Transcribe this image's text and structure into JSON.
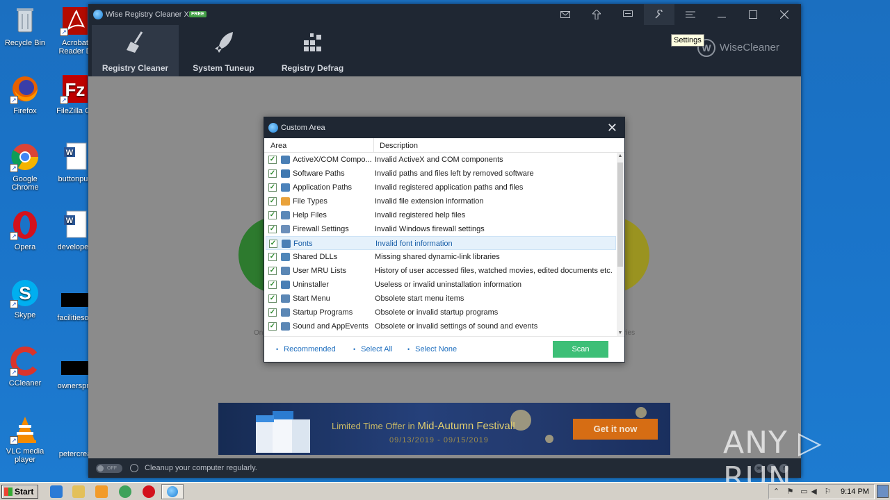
{
  "desktop": {
    "icons": [
      {
        "label": "Recycle Bin",
        "icon": "recycle-bin-icon"
      },
      {
        "label": "Acrobat Reader D",
        "icon": "acrobat-icon"
      },
      {
        "label": "Firefox",
        "icon": "firefox-icon"
      },
      {
        "label": "FileZilla Cli",
        "icon": "filezilla-icon"
      },
      {
        "label": "Google Chrome",
        "icon": "chrome-icon"
      },
      {
        "label": "buttonpub",
        "icon": "word-doc-icon"
      },
      {
        "label": "Opera",
        "icon": "opera-icon"
      },
      {
        "label": "developed",
        "icon": "word-doc-icon"
      },
      {
        "label": "Skype",
        "icon": "skype-icon"
      },
      {
        "label": "facilitiesop",
        "icon": "blank-file-icon"
      },
      {
        "label": "CCleaner",
        "icon": "ccleaner-icon"
      },
      {
        "label": "ownerspm",
        "icon": "blank-file-icon"
      },
      {
        "label": "VLC media player",
        "icon": "vlc-icon"
      },
      {
        "label": "petercrea",
        "icon": "blank-file-icon"
      }
    ]
  },
  "app": {
    "title": "Wise Registry Cleaner X",
    "badge": "FREE",
    "tabs": [
      {
        "label": "Registry Cleaner",
        "icon": "broom-icon"
      },
      {
        "label": "System Tuneup",
        "icon": "rocket-icon"
      },
      {
        "label": "Registry Defrag",
        "icon": "blocks-icon"
      }
    ],
    "brand": "WiseCleaner",
    "brand_letter": "W",
    "tooltip": "Settings",
    "status_toggle": "OFF",
    "status_text": "Cleanup your computer regularly.",
    "bg_left_text": "On",
    "bg_right_text": "ries",
    "banner": {
      "offer_prefix": "Limited Time Offer in",
      "offer_event": "Mid-Autumn Festival!",
      "dates": "09/13/2019 - 09/15/2019",
      "button": "Get it now"
    }
  },
  "dialog": {
    "title": "Custom Area",
    "col_area": "Area",
    "col_desc": "Description",
    "rows": [
      {
        "name": "ActiveX/COM Compo...",
        "desc": "Invalid ActiveX and COM components",
        "checked": true
      },
      {
        "name": "Software Paths",
        "desc": "Invalid paths and files left by removed software",
        "checked": true
      },
      {
        "name": "Application Paths",
        "desc": "Invalid registered application paths and files",
        "checked": true
      },
      {
        "name": "File Types",
        "desc": "Invalid file extension information",
        "checked": true
      },
      {
        "name": "Help Files",
        "desc": "Invalid registered help files",
        "checked": true
      },
      {
        "name": "Firewall Settings",
        "desc": "Invalid Windows firewall settings",
        "checked": true
      },
      {
        "name": "Fonts",
        "desc": "Invalid font information",
        "checked": true
      },
      {
        "name": "Shared DLLs",
        "desc": "Missing shared dynamic-link libraries",
        "checked": true
      },
      {
        "name": "User MRU Lists",
        "desc": "History of user accessed files, watched movies, edited documents etc.",
        "checked": true
      },
      {
        "name": "Uninstaller",
        "desc": "Useless or invalid uninstallation information",
        "checked": true
      },
      {
        "name": "Start Menu",
        "desc": "Obsolete start menu items",
        "checked": true
      },
      {
        "name": "Startup Programs",
        "desc": "Obsolete or invalid startup programs",
        "checked": true
      },
      {
        "name": "Sound and AppEvents",
        "desc": "Obsolete or invalid settings of sound and events",
        "checked": true
      }
    ],
    "selected_index": 6,
    "links": {
      "recommended": "Recommended",
      "select_all": "Select All",
      "select_none": "Select None"
    },
    "scan": "Scan"
  },
  "taskbar": {
    "start": "Start",
    "time": "9:14 PM"
  },
  "watermark": "ANY ▷ RUN"
}
